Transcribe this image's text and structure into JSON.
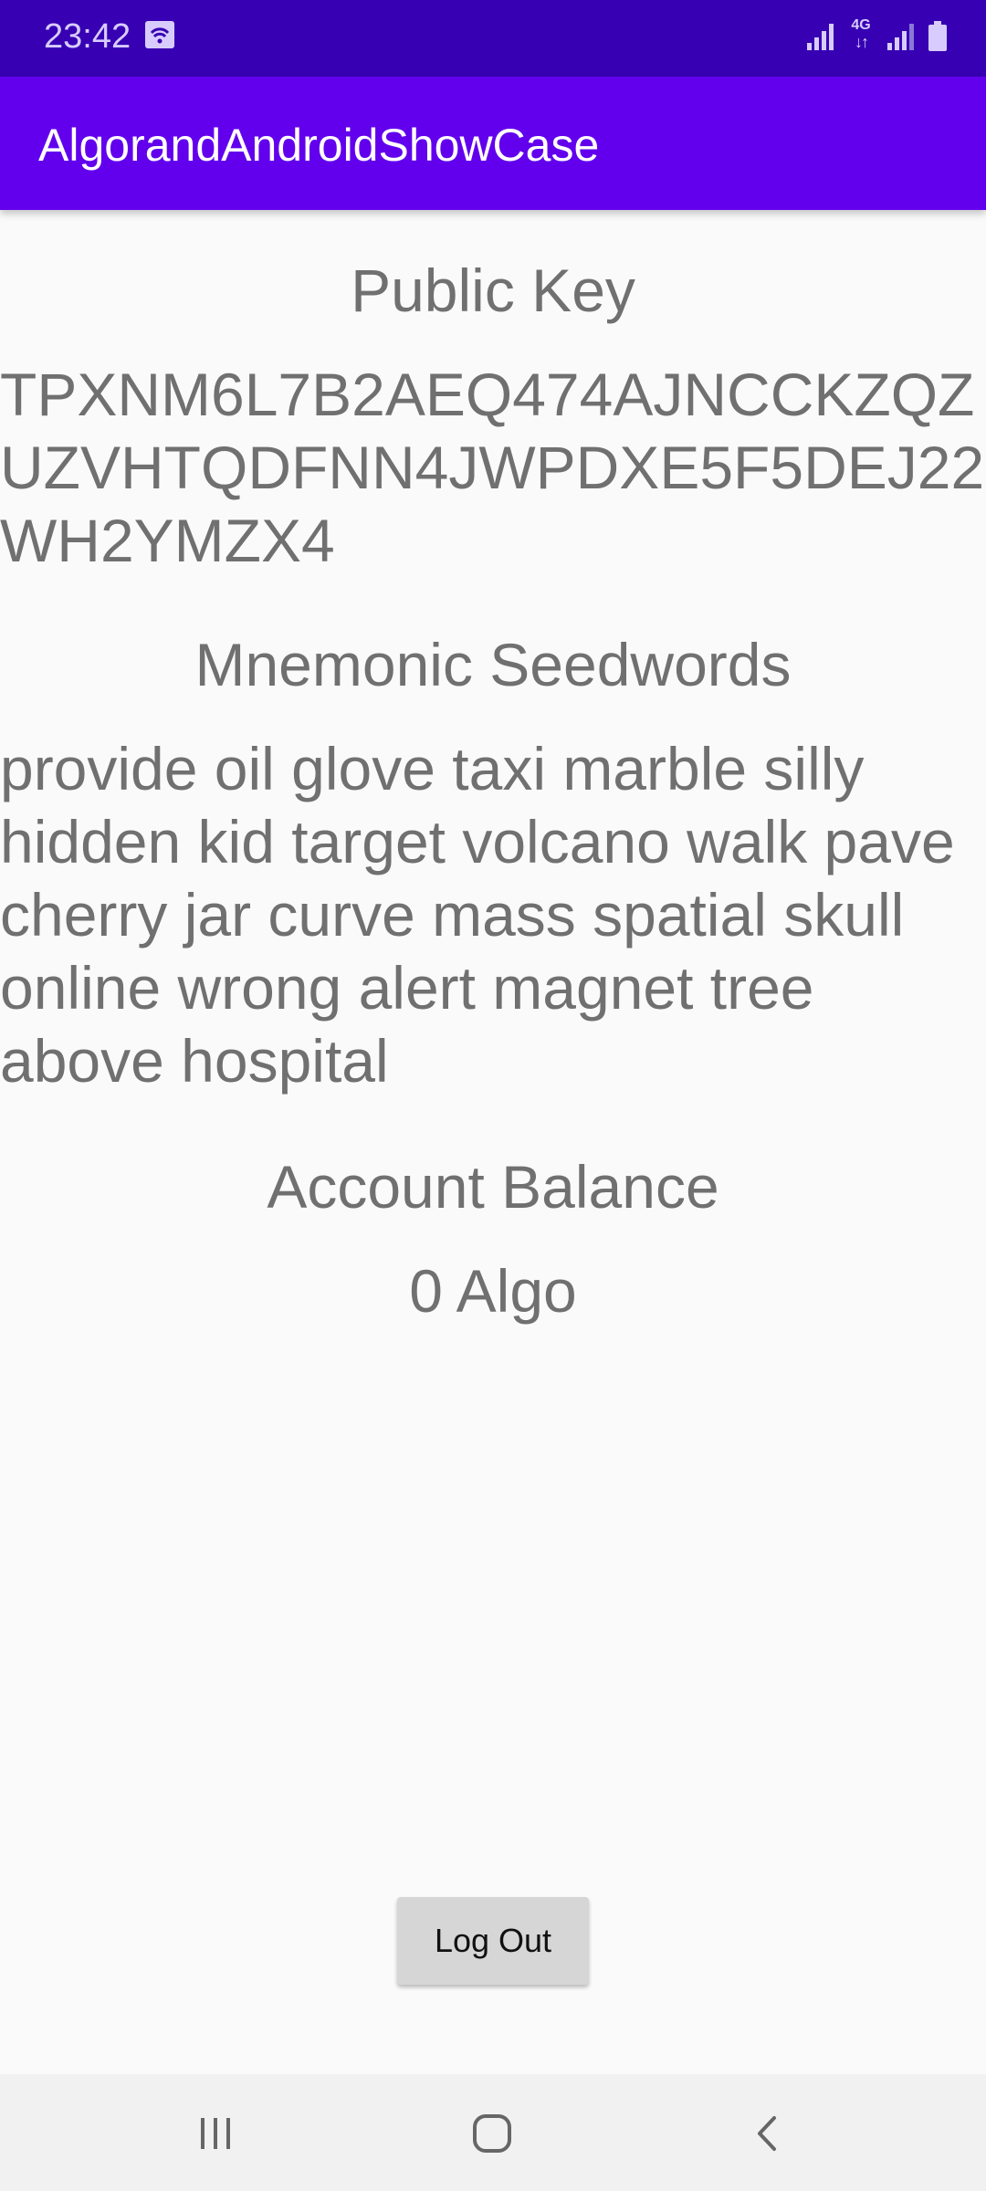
{
  "status_bar": {
    "time": "23:42",
    "network_label": "4G",
    "icons": [
      "hotspot-icon",
      "signal-icon",
      "network-4g-icon",
      "signal-icon",
      "battery-icon"
    ]
  },
  "app_bar": {
    "title": "AlgorandAndroidShowCase"
  },
  "main": {
    "public_key_title": "Public Key",
    "public_key_value": "TPXNM6L7B2AEQ474AJNCCKZQZUZVHTQDFNN4JWPDXE5F5DEJ22WH2YMZX4",
    "mnemonic_title": "Mnemonic Seedwords",
    "mnemonic_value": "provide oil glove taxi marble silly hidden kid target volcano walk pave cherry jar curve mass spatial skull online wrong alert magnet tree above hospital",
    "balance_title": "Account Balance",
    "balance_value": "0 Algo"
  },
  "actions": {
    "logout_label": "Log Out"
  },
  "nav_bar": {
    "icons": [
      "recent-apps-icon",
      "home-icon",
      "back-icon"
    ]
  },
  "colors": {
    "status_bar": "#3700b3",
    "app_bar": "#6200ee",
    "background": "#fafafa",
    "text": "#707070",
    "button": "#d6d6d6",
    "nav_bar": "#f1f1f1"
  }
}
